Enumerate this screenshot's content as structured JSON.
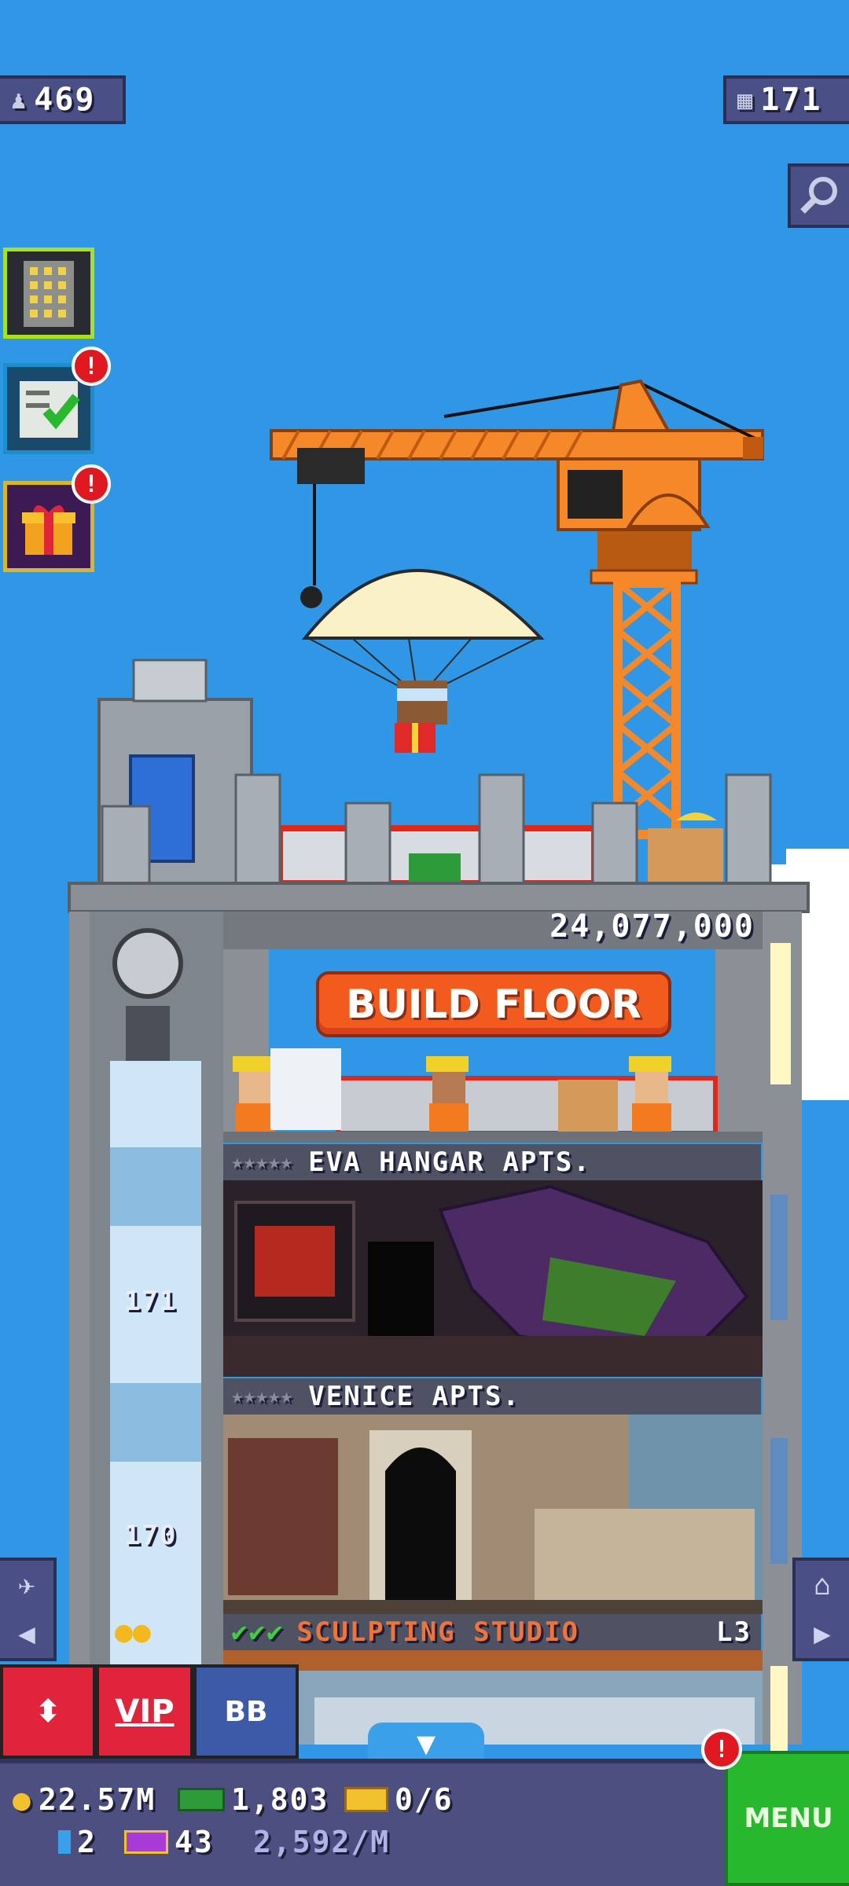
{
  "top": {
    "population": "469",
    "floors": "171"
  },
  "tower": {
    "build_cost": "24,077,000",
    "build_floor_label": "BUILD FLOOR",
    "floors": [
      {
        "name": "EVA HANGAR APTS.",
        "stars": "★★★★★"
      },
      {
        "name": "VENICE APTS.",
        "stars": "★★★★★"
      },
      {
        "name": "SCULPTING STUDIO",
        "checks": "✔✔✔",
        "level": "L3"
      }
    ],
    "elevator_numbers": [
      "171",
      "170"
    ]
  },
  "toolbar": {
    "elevator_label": "⬍",
    "vip_label": "VIP",
    "bb_label": "BB",
    "collapse_label": "▼"
  },
  "status": {
    "coins": "22.57M",
    "bux": "1,803",
    "tickets": "0/6",
    "keys": "2",
    "lucky": "43",
    "rate": "2,592/M"
  },
  "menu": {
    "label": "MENU",
    "alert": "!"
  },
  "alerts": {
    "missions": "!",
    "gifts": "!"
  },
  "colors": {
    "sky": "#2f97e6",
    "crane": "#f5892a",
    "build_button": "#f25a1e",
    "menu": "#27b82e",
    "vip": "#e0243c"
  }
}
